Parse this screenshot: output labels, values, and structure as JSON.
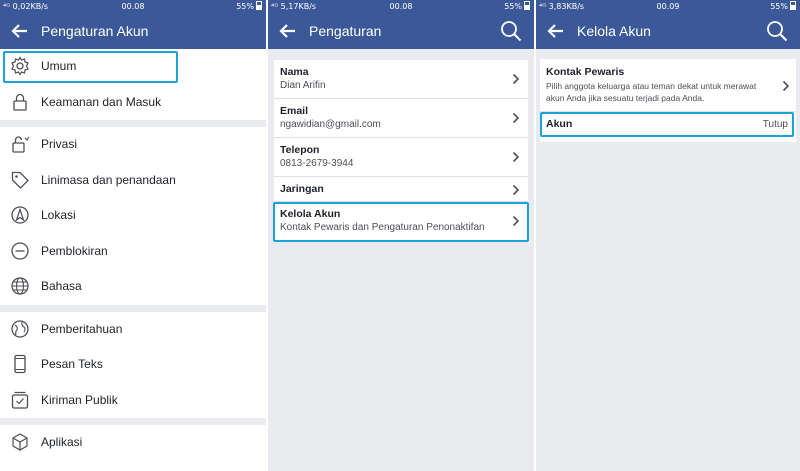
{
  "colors": {
    "brand": "#3b5998",
    "highlight": "#1aa3d6",
    "background": "#e9ebee"
  },
  "panel1": {
    "status": {
      "left": "⁴ᴳ 0,02KB/s",
      "time": "00.08",
      "right": "55%"
    },
    "header": {
      "title": "Pengaturan Akun",
      "back_icon": "arrow-left-icon"
    },
    "items": [
      {
        "label": "Umum",
        "icon": "gear-icon"
      },
      {
        "label": "Keamanan dan Masuk",
        "icon": "lock-icon"
      },
      {
        "label": "Privasi",
        "icon": "privacy-lock-icon"
      },
      {
        "label": "Linimasa dan penandaan",
        "icon": "tag-icon"
      },
      {
        "label": "Lokasi",
        "icon": "location-icon"
      },
      {
        "label": "Pemblokiran",
        "icon": "block-icon"
      },
      {
        "label": "Bahasa",
        "icon": "globe-icon"
      },
      {
        "label": "Pemberitahuan",
        "icon": "globe-notification-icon"
      },
      {
        "label": "Pesan Teks",
        "icon": "phone-icon"
      },
      {
        "label": "Kiriman Publik",
        "icon": "public-posts-icon"
      },
      {
        "label": "Aplikasi",
        "icon": "cube-icon"
      }
    ]
  },
  "panel2": {
    "status": {
      "left": "⁴ᴳ 5,17KB/s",
      "time": "00.08",
      "right": "55%"
    },
    "header": {
      "title": "Pengaturan",
      "back_icon": "arrow-left-icon",
      "search_icon": "search-icon"
    },
    "rows": [
      {
        "title": "Nama",
        "sub": "Dian Arifin"
      },
      {
        "title": "Email",
        "sub": "ngawidian@gmail.com"
      },
      {
        "title": "Telepon",
        "sub": "0813-2679-3944"
      },
      {
        "title": "Jaringan",
        "sub": ""
      },
      {
        "title": "Kelola Akun",
        "sub": "Kontak Pewaris dan Pengaturan Penonaktifan"
      }
    ]
  },
  "panel3": {
    "status": {
      "left": "⁴ᴳ 3,83KB/s",
      "time": "00.09",
      "right": "55%"
    },
    "header": {
      "title": "Kelola Akun",
      "back_icon": "arrow-left-icon",
      "search_icon": "search-icon"
    },
    "legacy": {
      "title": "Kontak Pewaris",
      "desc": "Pilih anggota keluarga atau teman dekat untuk merawat akun Anda jika sesuatu terjadi pada Anda."
    },
    "account": {
      "title": "Akun",
      "action": "Tutup"
    }
  }
}
